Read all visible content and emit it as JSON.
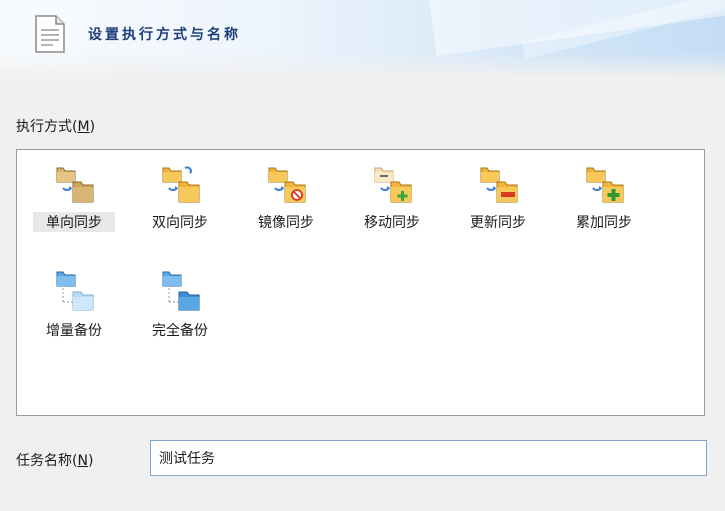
{
  "header": {
    "title": "设置执行方式与名称",
    "icon": "document-icon"
  },
  "exec_mode": {
    "label": "执行方式(",
    "mnemonic": "M",
    "label_close": ")",
    "selected": "单向同步",
    "items": [
      {
        "label": "单向同步",
        "icon": "one-way-sync-icon"
      },
      {
        "label": "双向同步",
        "icon": "two-way-sync-icon"
      },
      {
        "label": "镜像同步",
        "icon": "mirror-sync-icon"
      },
      {
        "label": "移动同步",
        "icon": "move-sync-icon"
      },
      {
        "label": "更新同步",
        "icon": "update-sync-icon"
      },
      {
        "label": "累加同步",
        "icon": "accumulate-sync-icon"
      },
      {
        "label": "增量备份",
        "icon": "incremental-backup-icon"
      },
      {
        "label": "完全备份",
        "icon": "full-backup-icon"
      }
    ]
  },
  "task_name": {
    "label": "任务名称(",
    "mnemonic": "N",
    "label_close": ")",
    "value": "测试任务"
  },
  "colors": {
    "folder_orange": "#f2b53a",
    "folder_blue": "#5aa7e6",
    "sync_arrow_blue": "#3a7bd5",
    "badge_red": "#d93a1f",
    "badge_green": "#3aa53a",
    "title_blue": "#1f3f7a"
  }
}
